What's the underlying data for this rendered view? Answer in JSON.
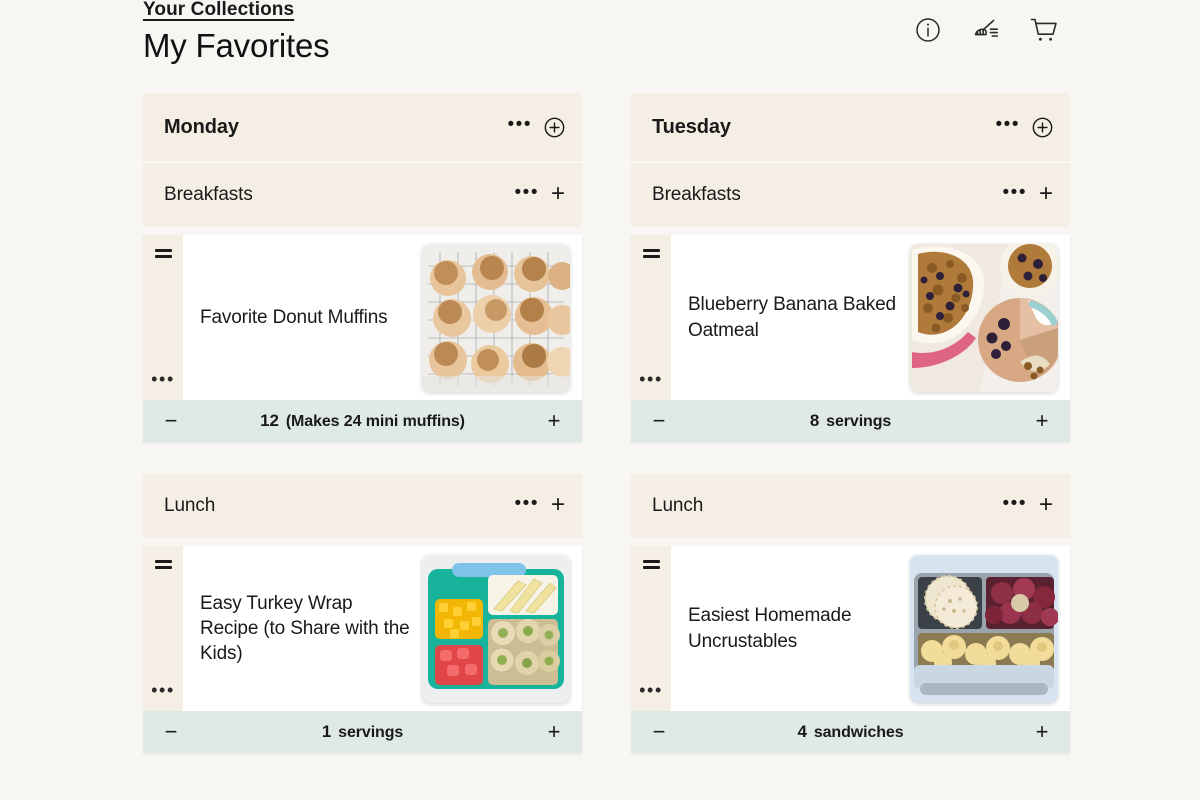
{
  "header": {
    "breadcrumb": "Your Collections",
    "title": "My Favorites",
    "icons": [
      {
        "name": "info-icon",
        "label": "Info"
      },
      {
        "name": "broom-icon",
        "label": "Clear plan"
      },
      {
        "name": "cart-icon",
        "label": "Shopping cart"
      }
    ]
  },
  "ui": {
    "dots": "•••",
    "plus": "+",
    "minus": "−"
  },
  "colors": {
    "page_bg": "#f7f6f3",
    "header_beige": "#f5eee4",
    "footer_teal": "#dfeae8",
    "card_white": "#ffffff",
    "text": "#1a1a1a"
  },
  "columns": [
    {
      "day": "Monday",
      "sections": [
        {
          "name": "Breakfasts",
          "recipes": [
            {
              "title": "Favorite Donut Muffins",
              "qty": "12",
              "unit": "(Makes 24 mini muffins)",
              "image_alt": "donut-muffins-on-cooling-rack"
            }
          ]
        },
        {
          "name": "Lunch",
          "recipes": [
            {
              "title": "Easy Turkey Wrap Recipe (to Share with the Kids)",
              "qty": "1",
              "unit": "servings",
              "image_alt": "turkey-wrap-pinwheels-in-green-bento-box"
            }
          ]
        }
      ]
    },
    {
      "day": "Tuesday",
      "sections": [
        {
          "name": "Breakfasts",
          "recipes": [
            {
              "title": "Blueberry Banana Baked Oatmeal",
              "qty": "8",
              "unit": "servings",
              "image_alt": "blueberry-baked-oatmeal-in-dish-and-bowls"
            }
          ]
        },
        {
          "name": "Lunch",
          "recipes": [
            {
              "title": "Easiest Homemade Uncrustables",
              "qty": "4",
              "unit": "sandwiches",
              "image_alt": "uncrustables-grapes-and-crackers-in-lunchbox"
            }
          ]
        }
      ]
    }
  ]
}
